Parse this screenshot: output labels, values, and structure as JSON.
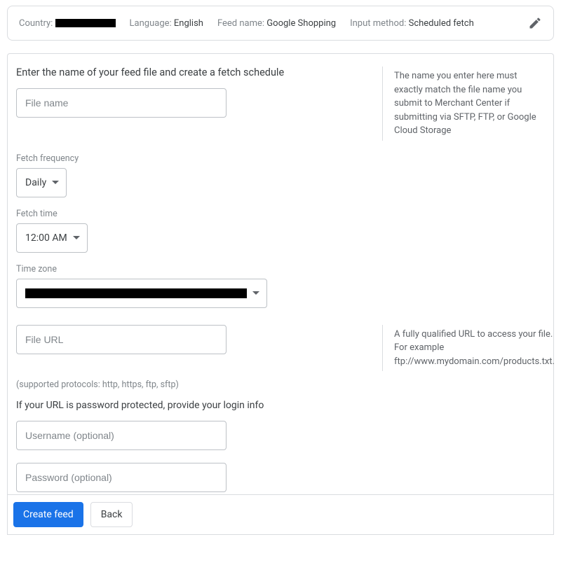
{
  "summary": {
    "country_label": "Country:",
    "language_label": "Language:",
    "language_value": "English",
    "feed_name_label": "Feed name:",
    "feed_name_value": "Google Shopping",
    "input_method_label": "Input method:",
    "input_method_value": "Scheduled fetch"
  },
  "section1": {
    "heading": "Enter the name of your feed file and create a fetch schedule",
    "file_name_placeholder": "File name",
    "help": "The name you enter here must exactly match the file name you submit to Merchant Center if submitting via SFTP, FTP, or Google Cloud Storage"
  },
  "fetch_frequency": {
    "label": "Fetch frequency",
    "value": "Daily"
  },
  "fetch_time": {
    "label": "Fetch time",
    "value": "12:00 AM"
  },
  "time_zone": {
    "label": "Time zone"
  },
  "file_url": {
    "placeholder": "File URL",
    "help": "A fully qualified URL to access your file. For example ftp://www.mydomain.com/products.txt.",
    "protocols_hint": "(supported protocols: http, https, ftp, sftp)"
  },
  "auth": {
    "heading": "If your URL is password protected, provide your login info",
    "username_placeholder": "Username (optional)",
    "password_placeholder": "Password (optional)"
  },
  "footer": {
    "create_label": "Create feed",
    "back_label": "Back"
  }
}
